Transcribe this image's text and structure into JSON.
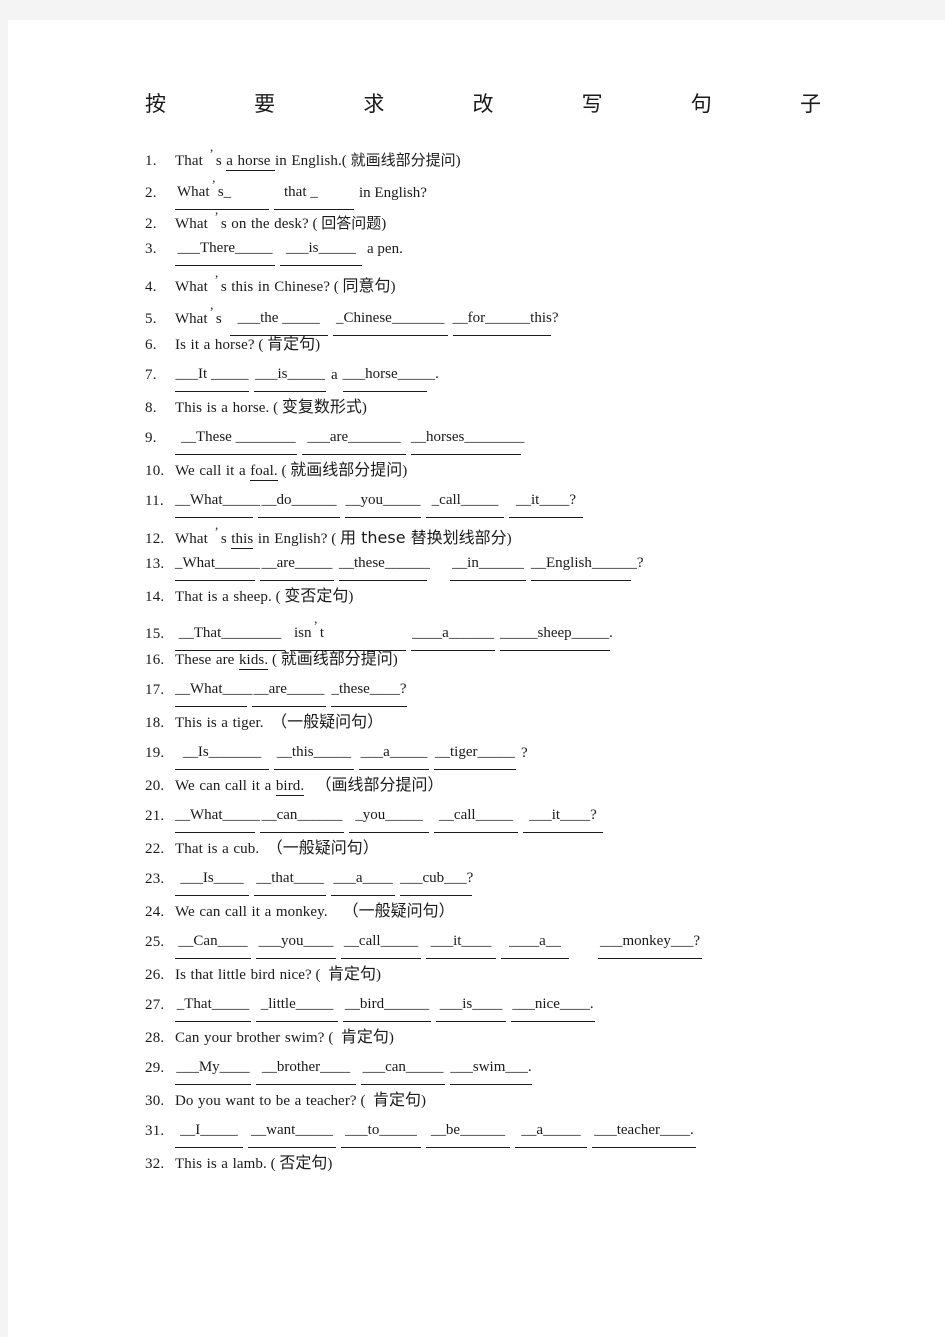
{
  "document": {
    "title_chars": [
      "按",
      "要",
      "求",
      "改",
      "写",
      "句",
      "子"
    ],
    "title_plain": "按要求改写句子",
    "page_bg": "#ffffff",
    "canvas_bg": "#f4f4f4",
    "text_color": "#1a1a1a"
  },
  "items": [
    {
      "num": "1.",
      "kind": "question",
      "text": "That ’ s a horse in English.( 就画线部分提问)",
      "english": "That ’ s a horse in English.",
      "underlined_part": "a horse",
      "instruction": "就画线部分提问"
    },
    {
      "num": "2.",
      "kind": "answer",
      "text": "What ’ s_    that _ in English?",
      "blanks": [
        "What ’ s_",
        "that _"
      ],
      "trailing": "in English?"
    },
    {
      "num": "2.",
      "kind": "question",
      "text": "What ’ s on the desk? ( 回答问题)",
      "english": "What ’ s on the desk?",
      "instruction": "回答问题"
    },
    {
      "num": "3.",
      "kind": "answer",
      "text": "___There_____ ___is_____ a pen.",
      "blanks": [
        "___There_____",
        "___is_____"
      ],
      "trailing": "a pen."
    },
    {
      "num": "4.",
      "kind": "question",
      "text": "What ’ s this in Chinese? ( 同意句)",
      "english": "What ’ s this in Chinese?",
      "instruction": "同意句"
    },
    {
      "num": "5.",
      "kind": "answer",
      "text": "What ’ s ___the _____ _Chinese_______ __for______this?",
      "lead": "What ’ s",
      "blanks": [
        "___the _____",
        "_Chinese_______",
        "__for______this?"
      ]
    },
    {
      "num": "6.",
      "kind": "question",
      "text": "Is it a horse? ( 肯定句)",
      "english": "Is it a horse?",
      "instruction": "肯定句"
    },
    {
      "num": "7.",
      "kind": "answer",
      "text": "___It _____ ___is_____ a ___horse_____.",
      "blanks": [
        "___It _____",
        "___is_____"
      ],
      "mid": "a",
      "blanks2": [
        "___horse_____."
      ]
    },
    {
      "num": "8.",
      "kind": "question",
      "text": "This is a horse. ( 变复数形式)",
      "english": "This is a horse.",
      "instruction": "变复数形式"
    },
    {
      "num": "9.",
      "kind": "answer",
      "text": "__These ________ ___are_______ __horses________",
      "blanks": [
        "__These ________",
        "___are_______",
        "__horses________"
      ]
    },
    {
      "num": "10.",
      "kind": "question",
      "text": "We call it a foal. ( 就画线部分提问)",
      "english": "We call it a foal.",
      "underlined_part": "foal.",
      "instruction": "就画线部分提问"
    },
    {
      "num": "11.",
      "kind": "answer",
      "text": "__What_____ __do______ __you_____ _call_____ __it____?",
      "blanks": [
        "__What_____",
        "__do______",
        "__you_____",
        "_call_____",
        "__it____?"
      ]
    },
    {
      "num": "12.",
      "kind": "question",
      "text": "What ’ s this in English? ( 用 these 替换划线部分)",
      "english": "What ’ s this in English?",
      "underlined_part": "this",
      "instruction": "用 these 替换划线部分"
    },
    {
      "num": "13.",
      "kind": "answer",
      "text": "_What______ __are_____ __these______   __in______ __English______?",
      "blanks": [
        "_What______",
        "__are_____",
        "__these______",
        "__in______",
        "__English______?"
      ]
    },
    {
      "num": "14.",
      "kind": "question",
      "text": "That is a sheep. ( 变否定句)",
      "english": "That is a sheep.",
      "instruction": "变否定句"
    },
    {
      "num": "15.",
      "kind": "answer",
      "text": "__That________ _isn ’ t________ ____a______ _____sheep_____.",
      "blanks": [
        "__That________",
        "_isn ’ t________",
        "____a______",
        "_____sheep_____."
      ]
    },
    {
      "num": "16.",
      "kind": "question",
      "text": "These are kids. ( 就画线部分提问)",
      "english": "These are kids.",
      "underlined_part": "kids.",
      "instruction": "就画线部分提问"
    },
    {
      "num": "17.",
      "kind": "answer",
      "text": "__What____ __are_____ _these____?",
      "blanks": [
        "__What____",
        "__are_____",
        "_these____?"
      ]
    },
    {
      "num": "18.",
      "kind": "question",
      "text": "This is a tiger. （一般疑问句）",
      "english": "This is a tiger.",
      "instruction": "（一般疑问句）"
    },
    {
      "num": "19.",
      "kind": "answer",
      "text": "__Is_______ __this_____ ___a_____ __tiger_____ ?",
      "blanks": [
        "__Is_______",
        "__this_____",
        "___a_____",
        "__tiger_____"
      ],
      "trailing": "?"
    },
    {
      "num": "20.",
      "kind": "question",
      "text": "We can call it a bird.  （画线部分提问）",
      "english": "We can call it a bird.",
      "underlined_part": "bird.",
      "instruction": "（画线部分提问）"
    },
    {
      "num": "21.",
      "kind": "answer",
      "text": "__What_____ __can______ _you_____ __call_____ ___it____?",
      "blanks": [
        "__What_____",
        "__can______",
        "_you_____",
        "__call_____",
        "___it____?"
      ]
    },
    {
      "num": "22.",
      "kind": "question",
      "text": "That is a cub.  （一般疑问句）",
      "english": "That is a cub.",
      "instruction": "（一般疑问句）"
    },
    {
      "num": "23.",
      "kind": "answer",
      "text": "___Is____ __that____ ___a____ ___cub___?",
      "blanks": [
        "___Is____",
        "__that____",
        "___a____",
        "___cub___?"
      ]
    },
    {
      "num": "24.",
      "kind": "question",
      "text": "We can call it a monkey.    （一般疑问句）",
      "english": "We can call it a monkey.",
      "instruction": "（一般疑问句）"
    },
    {
      "num": "25.",
      "kind": "answer",
      "text": "__Can____ ___you____ __call_____ ___it____ ____a__    ___monkey___?",
      "blanks": [
        "__Can____",
        "___you____",
        "__call_____",
        "___it____",
        "____a__"
      ],
      "blanks2": [
        "___monkey___?"
      ]
    },
    {
      "num": "26.",
      "kind": "question",
      "text": "Is that little bird nice? ( 肯定句)",
      "english": "Is that little bird nice?",
      "instruction": "肯定句"
    },
    {
      "num": "27.",
      "kind": "answer",
      "text": "_That_____ _little_____ __bird______ ___is____ ___nice____.",
      "blanks": [
        "_That_____",
        "_little_____",
        "__bird______",
        "___is____",
        "___nice____."
      ]
    },
    {
      "num": "28.",
      "kind": "question",
      "text": "Can your brother swim? ( 肯定句)",
      "english": "Can your brother swim?",
      "instruction": "肯定句"
    },
    {
      "num": "29.",
      "kind": "answer",
      "text": "___My____ __brother____ ___can_____ ___swim___.",
      "blanks": [
        "___My____",
        "__brother____",
        "___can_____",
        "___swim___."
      ]
    },
    {
      "num": "30.",
      "kind": "question",
      "text": "Do you want to be a teacher? ( 肯定句)",
      "english": "Do you want to be a teacher?",
      "instruction": "肯定句"
    },
    {
      "num": "31.",
      "kind": "answer",
      "text": "__I_____ __want_____ ___to_____ __be______ __a_____ ___teacher____.",
      "blanks": [
        "__I_____",
        "__want_____",
        "___to_____",
        "__be______",
        "__a_____",
        "___teacher____."
      ]
    },
    {
      "num": "32.",
      "kind": "question",
      "text": "This is a lamb. ( 否定句)",
      "english": "This is a lamb.",
      "instruction": "否定句"
    }
  ]
}
